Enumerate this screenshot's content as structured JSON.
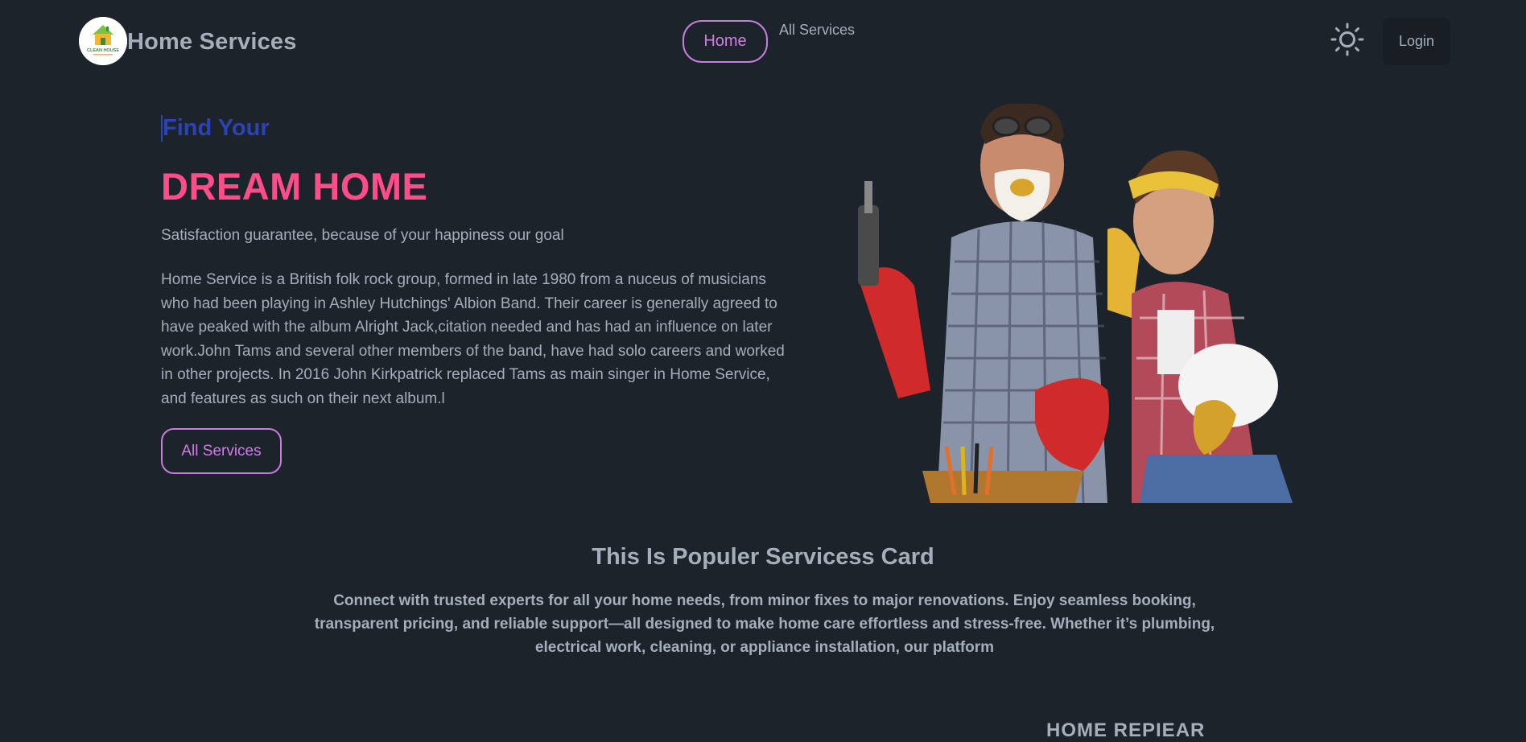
{
  "nav": {
    "brand": "Home Services",
    "logo_text": "CLEAN HOUSE",
    "home_label": "Home",
    "all_services_label": "All Services",
    "login_label": "Login",
    "theme_icon": "sun-icon"
  },
  "hero": {
    "eyebrow": "Find Your",
    "headline": "DREAM HOME",
    "subtitle": "Satisfaction guarantee, because of your happiness our goal",
    "paragraph": "Home Service is a British folk rock group, formed in late 1980 from a nuceus of musicians who had been playing in Ashley Hutchings' Albion Band. Their career is generally agreed to have peaked with the album Alright Jack,citation needed and has had an influence on later work.John Tams and several other members of the band, have had solo careers and worked in other projects. In 2016 John Kirkpatrick replaced Tams as main singer in Home Service, and features as such on their next album.l",
    "button_label": "All Services"
  },
  "popular": {
    "title": "This Is Populer Servicess Card",
    "description": "Connect with trusted experts for all your home needs, from minor fixes to major renovations. Enjoy seamless booking, transparent pricing, and reliable support—all designed to make home care effortless and stress-free. Whether it’s plumbing, electrical work, cleaning, or appliance installation, our platform",
    "card_peek": "HOME REPIEAR"
  },
  "colors": {
    "background": "#1d232a",
    "accent_purple": "#c77dde",
    "headline_pink": "#ff4d8a",
    "eyebrow_blue": "#2a44b5"
  }
}
